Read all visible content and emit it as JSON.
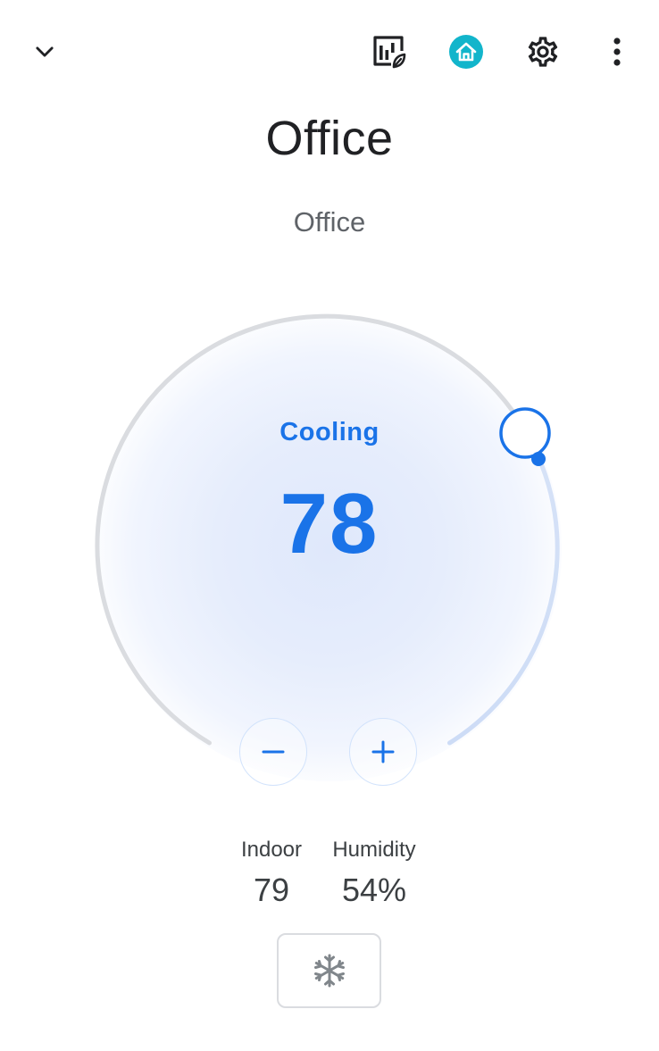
{
  "header": {
    "back_icon": "chevron-down-icon",
    "energy_icon": "energy-history-icon",
    "home_icon": "home-icon",
    "settings_icon": "gear-icon",
    "more_icon": "more-vert-icon",
    "home_accent": "#12b5cb"
  },
  "device": {
    "name": "Office",
    "room": "Office"
  },
  "thermostat": {
    "mode_status": "Cooling",
    "setpoint": "78",
    "setpoint_value": 78,
    "accent": "#1a73e8",
    "decrease_label": "−",
    "increase_label": "+"
  },
  "readings": {
    "indoor_label": "Indoor",
    "indoor_value": "79",
    "humidity_label": "Humidity",
    "humidity_value": "54%"
  },
  "mode_button": {
    "icon": "snowflake-icon"
  }
}
